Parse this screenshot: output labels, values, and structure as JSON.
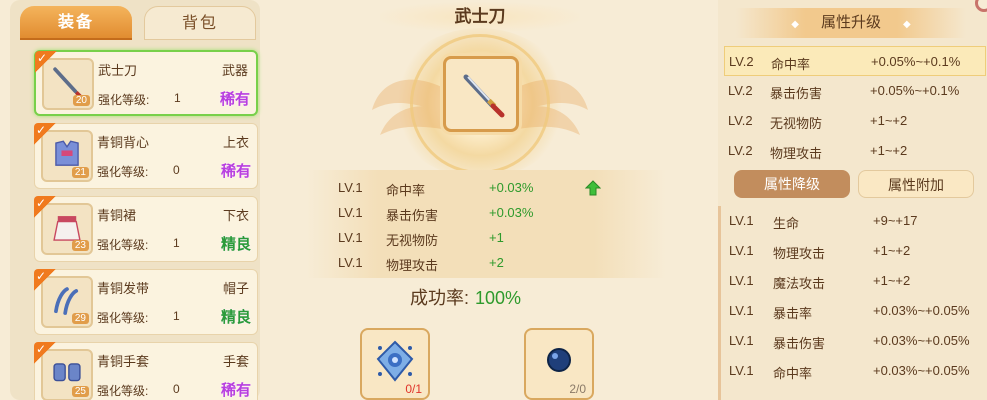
{
  "tabs": {
    "equipment": "装备",
    "bag": "背包"
  },
  "items": [
    {
      "name": "武士刀",
      "slot": "武器",
      "level": "20",
      "enh_label": "强化等级:",
      "enh_value": "1",
      "quality": "稀有",
      "quality_type": "rare",
      "selected": true,
      "icon": "katana-icon"
    },
    {
      "name": "青铜背心",
      "slot": "上衣",
      "level": "21",
      "enh_label": "强化等级:",
      "enh_value": "0",
      "quality": "稀有",
      "quality_type": "rare",
      "selected": false,
      "icon": "vest-icon"
    },
    {
      "name": "青铜裙",
      "slot": "下衣",
      "level": "23",
      "enh_label": "强化等级:",
      "enh_value": "1",
      "quality": "精良",
      "quality_type": "good",
      "selected": false,
      "icon": "skirt-icon"
    },
    {
      "name": "青铜发带",
      "slot": "帽子",
      "level": "29",
      "enh_label": "强化等级:",
      "enh_value": "1",
      "quality": "精良",
      "quality_type": "good",
      "selected": false,
      "icon": "headband-icon"
    },
    {
      "name": "青铜手套",
      "slot": "手套",
      "level": "25",
      "enh_label": "强化等级:",
      "enh_value": "0",
      "quality": "稀有",
      "quality_type": "rare",
      "selected": false,
      "icon": "gloves-icon"
    }
  ],
  "center": {
    "title": "武士刀",
    "stats": [
      {
        "lv": "LV.1",
        "name": "命中率",
        "value": "+0.03%",
        "arrow": true
      },
      {
        "lv": "LV.1",
        "name": "暴击伤害",
        "value": "+0.03%",
        "arrow": false
      },
      {
        "lv": "LV.1",
        "name": "无视物防",
        "value": "+1",
        "arrow": false
      },
      {
        "lv": "LV.1",
        "name": "物理攻击",
        "value": "+2",
        "arrow": false
      }
    ],
    "success_label": "成功率:",
    "success_value": "100%",
    "materials": [
      {
        "count": "0/1",
        "count_color": "red",
        "icon": "blue-gem-icon"
      },
      {
        "count": "2/0",
        "count_color": "gray",
        "icon": "dark-orb-icon"
      }
    ]
  },
  "right": {
    "header": "属性升级",
    "upgrades": [
      {
        "lv": "LV.2",
        "name": "命中率",
        "range": "+0.05%~+0.1%",
        "highlight": true
      },
      {
        "lv": "LV.2",
        "name": "暴击伤害",
        "range": "+0.05%~+0.1%",
        "highlight": false
      },
      {
        "lv": "LV.2",
        "name": "无视物防",
        "range": "+1~+2",
        "highlight": false
      },
      {
        "lv": "LV.2",
        "name": "物理攻击",
        "range": "+1~+2",
        "highlight": false
      }
    ],
    "sub_tab_active": "属性降级",
    "sub_tab_inactive": "属性附加",
    "downgrades": [
      {
        "lv": "LV.1",
        "name": "生命",
        "range": "+9~+17"
      },
      {
        "lv": "LV.1",
        "name": "物理攻击",
        "range": "+1~+2"
      },
      {
        "lv": "LV.1",
        "name": "魔法攻击",
        "range": "+1~+2"
      },
      {
        "lv": "LV.1",
        "name": "暴击率",
        "range": "+0.03%~+0.05%"
      },
      {
        "lv": "LV.1",
        "name": "暴击伤害",
        "range": "+0.03%~+0.05%"
      },
      {
        "lv": "LV.1",
        "name": "命中率",
        "range": "+0.03%~+0.05%"
      }
    ]
  },
  "colors": {
    "rare": "#b83fe0",
    "good": "#2a9b3a",
    "positive": "#2e9a2c",
    "accent": "#e08a2e"
  }
}
